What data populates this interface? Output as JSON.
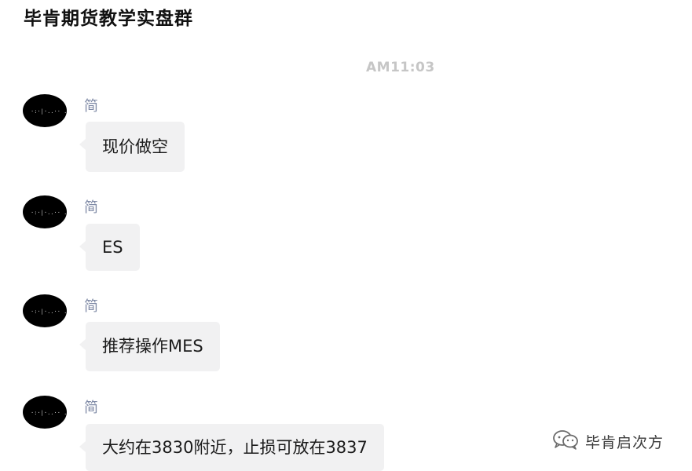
{
  "chat": {
    "title": "毕肯期货教学实盘群",
    "timestamp": "AM11:03"
  },
  "messages": [
    {
      "sender": "简",
      "text": "现价做空"
    },
    {
      "sender": "简",
      "text": "ES"
    },
    {
      "sender": "简",
      "text": "推荐操作MES"
    },
    {
      "sender": "简",
      "text": "大约在3830附近，止损可放在3837"
    }
  ],
  "watermark": {
    "icon": "wechat-official-account-icon",
    "text": "毕肯启次方"
  }
}
